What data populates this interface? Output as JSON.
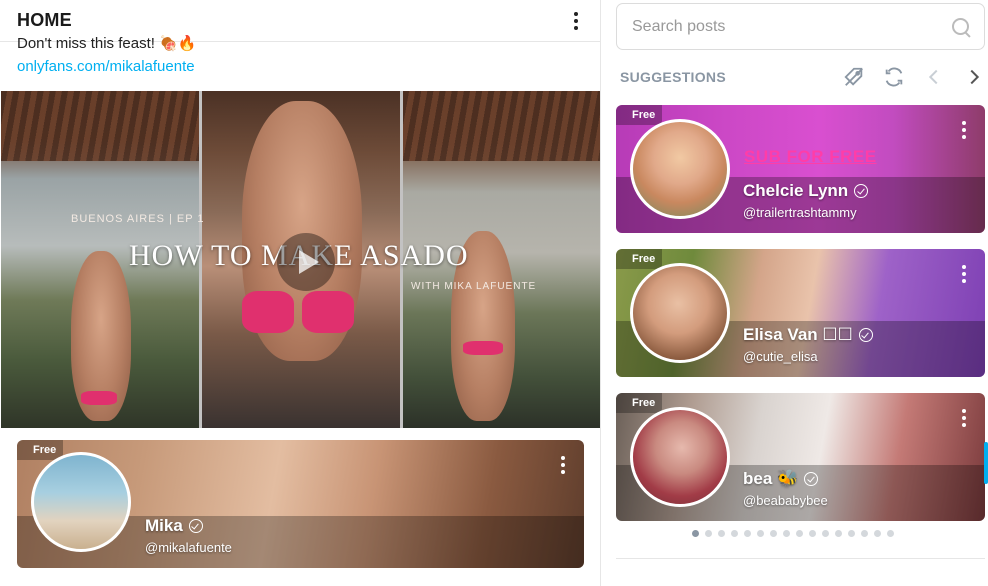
{
  "feed": {
    "title": "HOME",
    "post_text": "Don't miss this feast! 🍖🔥",
    "post_link": "onlyfans.com/mikalafuente",
    "media": {
      "subtitle_top": "BUENOS AIRES | EP 1",
      "title": "HOW TO MAKE ASADO",
      "subtitle_bottom": "WITH MIKA LAFUENTE"
    },
    "profile_card": {
      "badge": "Free",
      "name": "Mika",
      "handle": "@mikalafuente"
    }
  },
  "sidebar": {
    "search": {
      "placeholder": "Search posts"
    },
    "suggestions_title": "SUGGESTIONS",
    "cards": [
      {
        "badge": "Free",
        "name": "Chelcie Lynn",
        "handle": "@trailertrashtammy",
        "banner_text": "SUB FOR FREE"
      },
      {
        "badge": "Free",
        "name": "Elisa Van ☐☐",
        "handle": "@cutie_elisa"
      },
      {
        "badge": "Free",
        "name": "bea 🐝",
        "handle": "@beababybee"
      }
    ],
    "pagination": {
      "total": 16,
      "active": 0
    }
  },
  "colors": {
    "accent": "#00aff0",
    "muted": "#8a96a3",
    "border": "#e6e6e6"
  }
}
